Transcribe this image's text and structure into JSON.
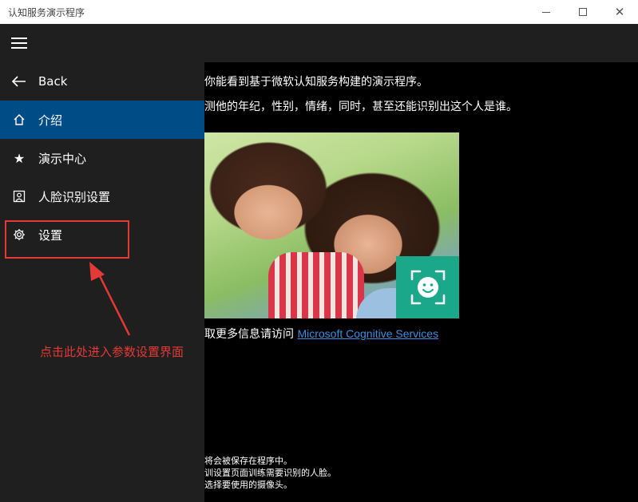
{
  "window": {
    "title": "认知服务演示程序",
    "min_icon": "minimize-icon",
    "max_icon": "maximize-icon",
    "close_icon": "close-icon"
  },
  "sidebar": {
    "menu_icon": "hamburger-icon",
    "back_label": "Back",
    "items": [
      {
        "label": "介绍",
        "icon": "home-icon",
        "selected": true
      },
      {
        "label": "演示中心",
        "icon": "star-icon",
        "selected": false
      },
      {
        "label": "人脸识别设置",
        "icon": "portrait-icon",
        "selected": false
      },
      {
        "label": "设置",
        "icon": "gear-icon",
        "selected": false
      }
    ]
  },
  "content": {
    "line1": "你能看到基于微软认知服务构建的演示程序。",
    "line2": "测他的年纪，性别，情绪，同时，甚至还能识别出这个人是谁。",
    "more_prefix": "取更多信息请访问 ",
    "more_link": "Microsoft Cognitive Services",
    "notes": [
      "将会被保存在程序中。",
      "训设置页面训练需要识别的人脸。",
      "选择要使用的摄像头。"
    ]
  },
  "annotation": {
    "callout": "点击此处进入参数设置界面",
    "color": "#e53935"
  },
  "colors": {
    "selected_nav": "#004c87",
    "sidebar_bg": "#1f1f1f",
    "badge": "#1ba88a",
    "link": "#3c8fe0"
  }
}
